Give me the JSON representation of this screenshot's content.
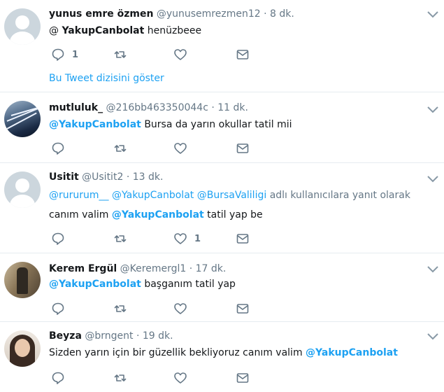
{
  "tweets": [
    {
      "name": "yunus emre özmen",
      "handle": "@yunusemrezmen12",
      "dot": "·",
      "time": "8 dk.",
      "text_prefix": "@",
      "mention": "YakupCanbolat",
      "text_suffix": " henüzbeee",
      "reply_count": "1",
      "thread_link": "Bu Tweet dizisini göster"
    },
    {
      "name": "mutluluk_",
      "handle": "@216bb463350044c",
      "dot": "·",
      "time": "11 dk.",
      "mention": "@YakupCanbolat",
      "text_suffix": " Bursa da yarın okullar tatil mii"
    },
    {
      "name": "Usitit",
      "handle": "@Usitit2",
      "dot": "·",
      "time": "13 dk.",
      "reply_mentions": [
        "@rururum__",
        "@YakupCanbolat",
        "@BursaValiligi"
      ],
      "reply_suffix": "adlı kullanıcılara yanıt olarak",
      "text_prefix": "canım valim ",
      "mention": "@YakupCanbolat",
      "text_suffix": " tatil yap be",
      "like_count": "1"
    },
    {
      "name": "Kerem Ergül",
      "handle": "@Keremergl1",
      "dot": "·",
      "time": "17 dk.",
      "mention": "@YakupCanbolat",
      "text_suffix": " başganım tatil yap"
    },
    {
      "name": "Beyza",
      "handle": "@brngent",
      "dot": "·",
      "time": "19 dk.",
      "text_prefix": "Sizden yarın için bir güzellik bekliyoruz canım valim ",
      "mention": "@YakupCanbolat"
    }
  ],
  "icons": {
    "reply": "reply-icon",
    "retweet": "retweet-icon",
    "like": "like-icon",
    "dm": "message-icon",
    "caret": "chevron-down-icon"
  },
  "colors": {
    "accent": "#1da1f2",
    "muted": "#657786",
    "text": "#14171a",
    "divider": "#e6ecf0"
  }
}
